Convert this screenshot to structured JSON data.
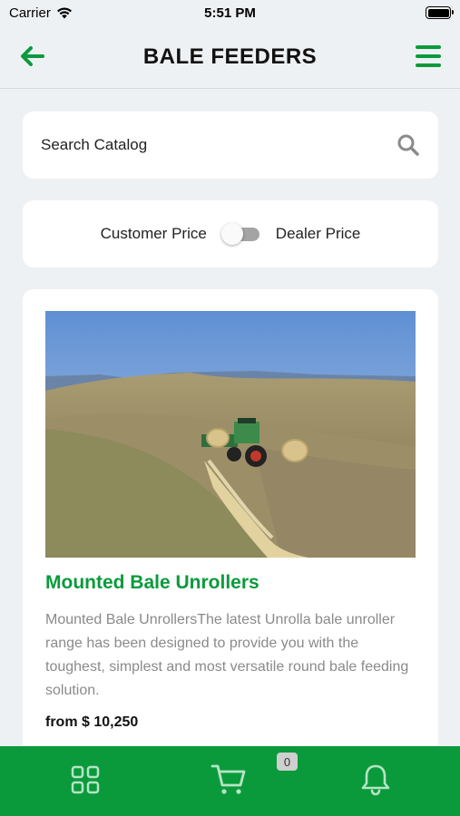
{
  "status_bar": {
    "carrier": "Carrier",
    "time": "5:51 PM"
  },
  "header": {
    "title": "BALE FEEDERS",
    "back_icon": "arrow-left-icon",
    "menu_icon": "hamburger-menu-icon"
  },
  "search": {
    "placeholder": "Search Catalog",
    "icon": "search-icon"
  },
  "price_toggle": {
    "left_label": "Customer Price",
    "right_label": "Dealer Price",
    "dealer_enabled": false
  },
  "products": [
    {
      "title": "Mounted Bale Unrollers",
      "description": "Mounted Bale UnrollersThe latest Unrolla bale unroller range has been designed to provide you with the toughest, simplest and most versatile round bale feeding solution.",
      "price": "from $ 10,250"
    }
  ],
  "bottom_nav": {
    "items": [
      "grid-icon",
      "cart-icon",
      "bell-icon"
    ],
    "cart_count": "0"
  },
  "colors": {
    "brand_green": "#0a9a3c",
    "background": "#eef1f4",
    "card": "#ffffff"
  }
}
